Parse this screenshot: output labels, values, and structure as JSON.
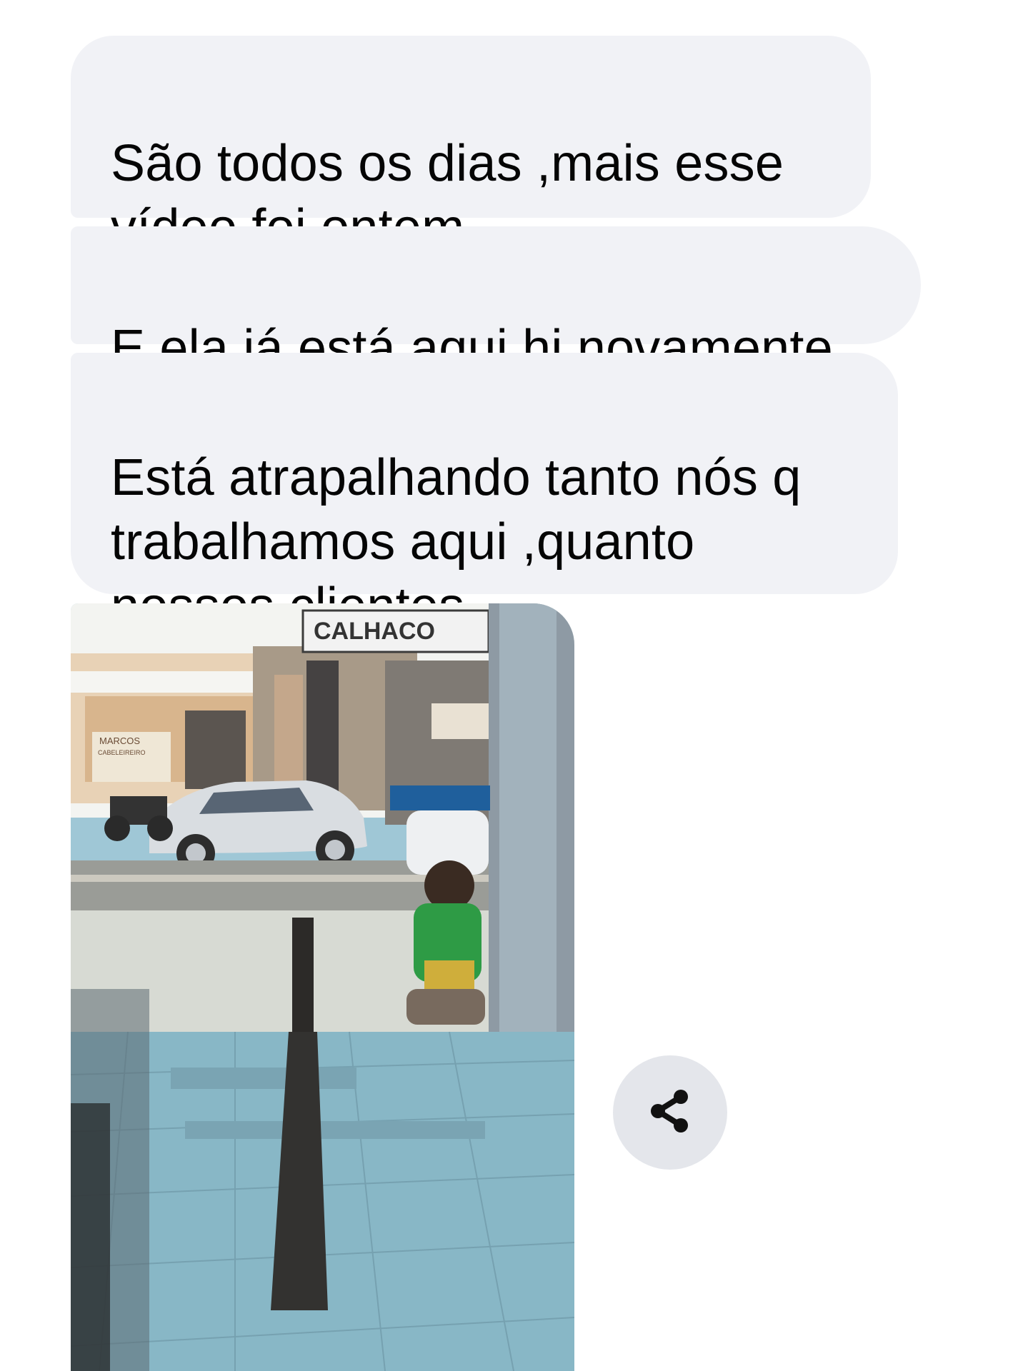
{
  "messages": [
    {
      "text": "São todos os dias ,mais esse\nvídeo foi ontem"
    },
    {
      "text": "E ela já está aqui hj novamente"
    },
    {
      "text": "Está atrapalhando tanto nós q\ntrabalhamos aqui ,quanto\nnossos clientes"
    }
  ],
  "video": {
    "signs": {
      "store_name": "CALHACO",
      "barber_name": "MARCOS",
      "barber_sub": "CABELEIREIRO"
    }
  },
  "share_button": {
    "icon": "share-icon"
  },
  "colors": {
    "bubble_background": "#f1f2f6",
    "text": "#050505",
    "share_background": "#e4e6eb"
  }
}
